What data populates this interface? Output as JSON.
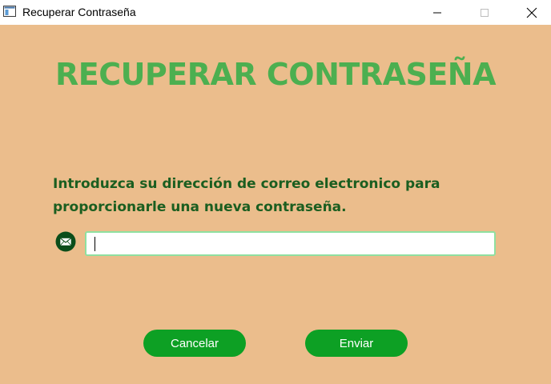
{
  "window": {
    "title": "Recuperar Contraseña",
    "minimize_icon": "minimize-icon",
    "maximize_icon": "maximize-icon",
    "close_icon": "close-icon"
  },
  "main": {
    "heading": "RECUPERAR CONTRASEÑA",
    "instruction": "Introduzca su dirección de correo electronico para proporcionarle una nueva contraseña.",
    "email_icon": "envelope-icon",
    "email_value": "",
    "cancel_label": "Cancelar",
    "send_label": "Enviar"
  },
  "colors": {
    "background": "#EBBD8C",
    "heading": "#4CAF50",
    "instruction": "#1B5E20",
    "button": "#0DA024",
    "input_border": "#8FE0A0"
  }
}
